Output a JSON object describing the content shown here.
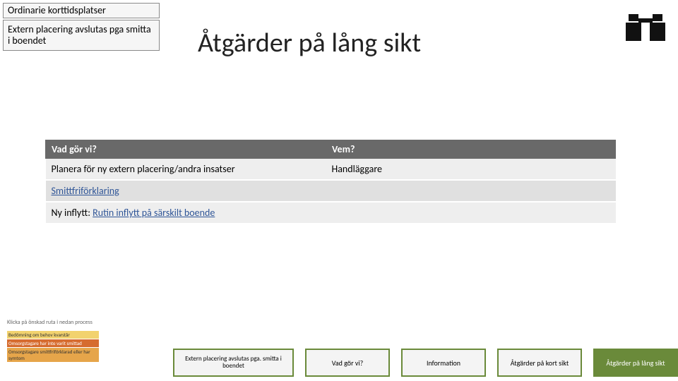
{
  "breadcrumb": {
    "item1": "Ordinarie korttidsplatser",
    "item2": "Extern placering avslutas pga smitta i boendet"
  },
  "page_title": "Åtgärder på lång sikt",
  "table": {
    "header_col1": "Vad gör vi?",
    "header_col2": "Vem?",
    "r1c1": "Planera för ny extern placering/andra insatser",
    "r1c2": "Handläggare",
    "r2c1_link": "Smittfriförklaring",
    "r3c1_prefix": "Ny inflytt: ",
    "r3c1_link": "Rutin inflytt på särskilt boende"
  },
  "footer_caption": "Klicka på önskad ruta i nedan process",
  "legend": {
    "a": "Bedömning om behov kvarstår",
    "b": "Omsorgstagare har inte varit smittad",
    "c": "Omsorgstagare smittfriförklarad eller har symtom"
  },
  "nav": {
    "n1": "Extern placering avslutas pga. smitta i boendet",
    "n2": "Vad gör vi?",
    "n3": "Information",
    "n4": "Åtgärder på kort sikt",
    "n5": "Åtgärder på lång sikt"
  }
}
